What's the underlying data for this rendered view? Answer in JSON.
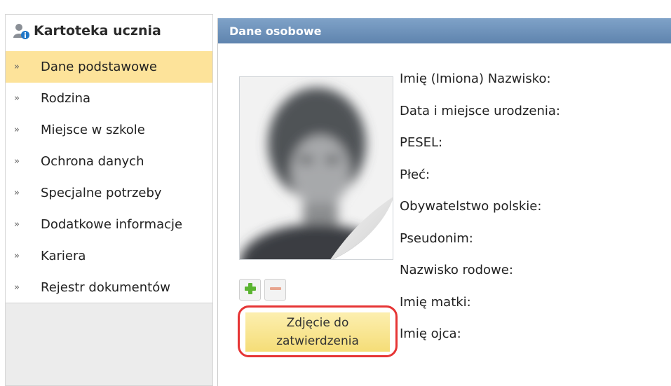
{
  "sidebar": {
    "title": "Kartoteka ucznia",
    "items": [
      {
        "label": "Dane podstawowe",
        "active": true
      },
      {
        "label": "Rodzina"
      },
      {
        "label": "Miejsce w szkole"
      },
      {
        "label": "Ochrona danych"
      },
      {
        "label": "Specjalne potrzeby"
      },
      {
        "label": "Dodatkowe informacje"
      },
      {
        "label": "Kariera"
      },
      {
        "label": "Rejestr dokumentów"
      }
    ],
    "chevron": "»",
    "icons": {
      "header": "person-info-icon"
    }
  },
  "panel": {
    "title": "Dane osobowe",
    "photo": {
      "add_icon": "plus-icon",
      "remove_icon": "minus-icon",
      "status_line1": "Zdjęcie do",
      "status_line2": "zatwierdzenia"
    },
    "fields": [
      "Imię (Imiona) Nazwisko:",
      "Data i miejsce urodzenia:",
      "PESEL:",
      "Płeć:",
      "Obywatelstwo polskie:",
      "Pseudonim:",
      "Nazwisko rodowe:",
      "Imię matki:",
      "Imię ojca:"
    ]
  },
  "colors": {
    "header_bar": "#6b8fb8",
    "active_item": "#fde39a",
    "highlight_border": "#e63535",
    "add_green": "#5bb431",
    "remove_red": "#e8a58f"
  }
}
